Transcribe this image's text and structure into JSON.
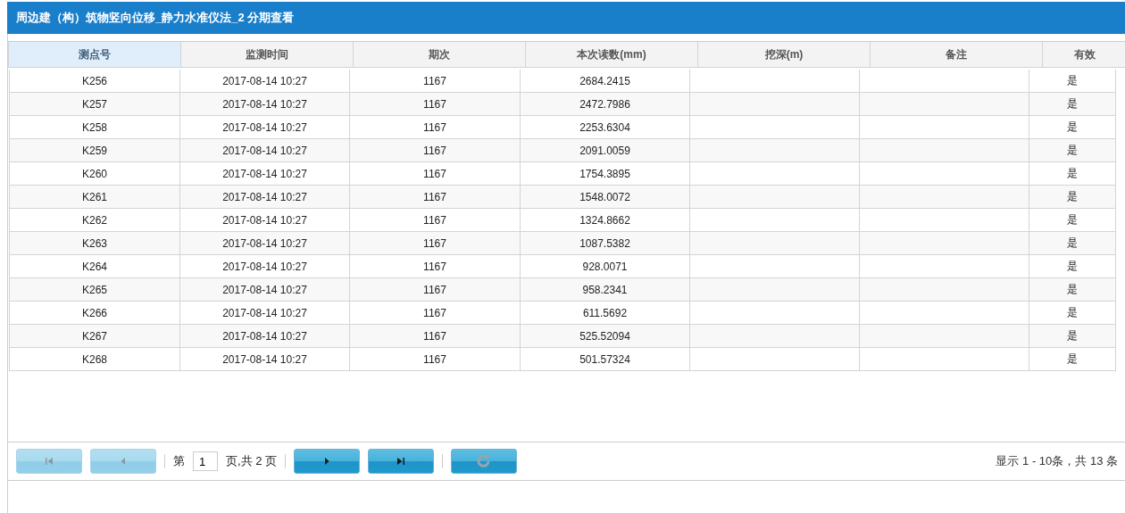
{
  "window": {
    "title": "周边建（构）筑物竖向位移_静力水准仪法_2 分期查看"
  },
  "table": {
    "columns": [
      {
        "label": "测点号",
        "selected": true
      },
      {
        "label": "监测时间",
        "selected": false
      },
      {
        "label": "期次",
        "selected": false
      },
      {
        "label": "本次读数(mm)",
        "selected": false
      },
      {
        "label": "挖深(m)",
        "selected": false
      },
      {
        "label": "备注",
        "selected": false
      },
      {
        "label": "有效",
        "selected": false
      }
    ],
    "rows": [
      [
        "K256",
        "2017-08-14 10:27",
        "1167",
        "2684.2415",
        "",
        "",
        "是"
      ],
      [
        "K257",
        "2017-08-14 10:27",
        "1167",
        "2472.7986",
        "",
        "",
        "是"
      ],
      [
        "K258",
        "2017-08-14 10:27",
        "1167",
        "2253.6304",
        "",
        "",
        "是"
      ],
      [
        "K259",
        "2017-08-14 10:27",
        "1167",
        "2091.0059",
        "",
        "",
        "是"
      ],
      [
        "K260",
        "2017-08-14 10:27",
        "1167",
        "1754.3895",
        "",
        "",
        "是"
      ],
      [
        "K261",
        "2017-08-14 10:27",
        "1167",
        "1548.0072",
        "",
        "",
        "是"
      ],
      [
        "K262",
        "2017-08-14 10:27",
        "1167",
        "1324.8662",
        "",
        "",
        "是"
      ],
      [
        "K263",
        "2017-08-14 10:27",
        "1167",
        "1087.5382",
        "",
        "",
        "是"
      ],
      [
        "K264",
        "2017-08-14 10:27",
        "1167",
        "928.0071",
        "",
        "",
        "是"
      ],
      [
        "K265",
        "2017-08-14 10:27",
        "1167",
        "958.2341",
        "",
        "",
        "是"
      ],
      [
        "K266",
        "2017-08-14 10:27",
        "1167",
        "611.5692",
        "",
        "",
        "是"
      ],
      [
        "K267",
        "2017-08-14 10:27",
        "1167",
        "525.52094",
        "",
        "",
        "是"
      ],
      [
        "K268",
        "2017-08-14 10:27",
        "1167",
        "501.57324",
        "",
        "",
        "是"
      ]
    ]
  },
  "pager": {
    "buttons": [
      {
        "kind": "first",
        "disabled": true
      },
      {
        "kind": "prev",
        "disabled": true
      },
      {
        "kind": "sep"
      },
      {
        "kind": "page"
      },
      {
        "kind": "sep"
      },
      {
        "kind": "next",
        "disabled": false
      },
      {
        "kind": "last",
        "disabled": false
      },
      {
        "kind": "sep"
      },
      {
        "kind": "refresh",
        "disabled": false
      }
    ],
    "page_prefix": "第",
    "page_value": "1",
    "page_suffix": "页,共 2 页",
    "summary": "显示 1 - 10条，共 13 条"
  }
}
